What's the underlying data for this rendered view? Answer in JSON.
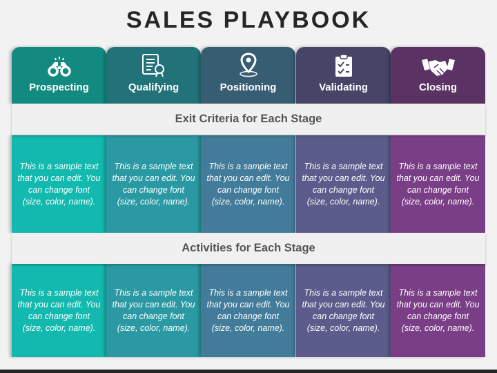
{
  "title": "SALES PLAYBOOK",
  "bands": {
    "exit": "Exit Criteria for Each Stage",
    "activities": "Activities for Each Stage"
  },
  "stages": [
    {
      "label": "Prospecting",
      "icon": "binoculars-icon",
      "head": "#138a80",
      "body": "#13b9ae",
      "exit_text": "This is a sample text that you can edit. You can change font (size, color, name).",
      "activities_text": "This is a sample text that you can edit. You can change font (size, color, name)."
    },
    {
      "label": "Qualifying",
      "icon": "certificate-icon",
      "head": "#227379",
      "body": "#2a99a3",
      "exit_text": "This is a sample text that you can edit. You can change font (size, color, name).",
      "activities_text": "This is a sample text that you can edit. You can change font (size, color, name)."
    },
    {
      "label": "Positioning",
      "icon": "location-pin-icon",
      "head": "#365d72",
      "body": "#427c9a",
      "exit_text": "This is a sample text that you can edit. You can change font (size, color, name).",
      "activities_text": "This is a sample text that you can edit. You can change font (size, color, name)."
    },
    {
      "label": "Validating",
      "icon": "clipboard-checklist-icon",
      "head": "#464568",
      "body": "#5c5c8c",
      "exit_text": "This is a sample text that you can edit. You can change font (size, color, name).",
      "activities_text": "This is a sample text that you can edit. You can change font (size, color, name)."
    },
    {
      "label": "Closing",
      "icon": "handshake-icon",
      "head": "#5a3263",
      "body": "#7a3e86",
      "exit_text": "This is a sample text that you can edit. You can change font (size, color, name).",
      "activities_text": "This is a sample text that you can edit. You can change font (size, color, name)."
    }
  ]
}
